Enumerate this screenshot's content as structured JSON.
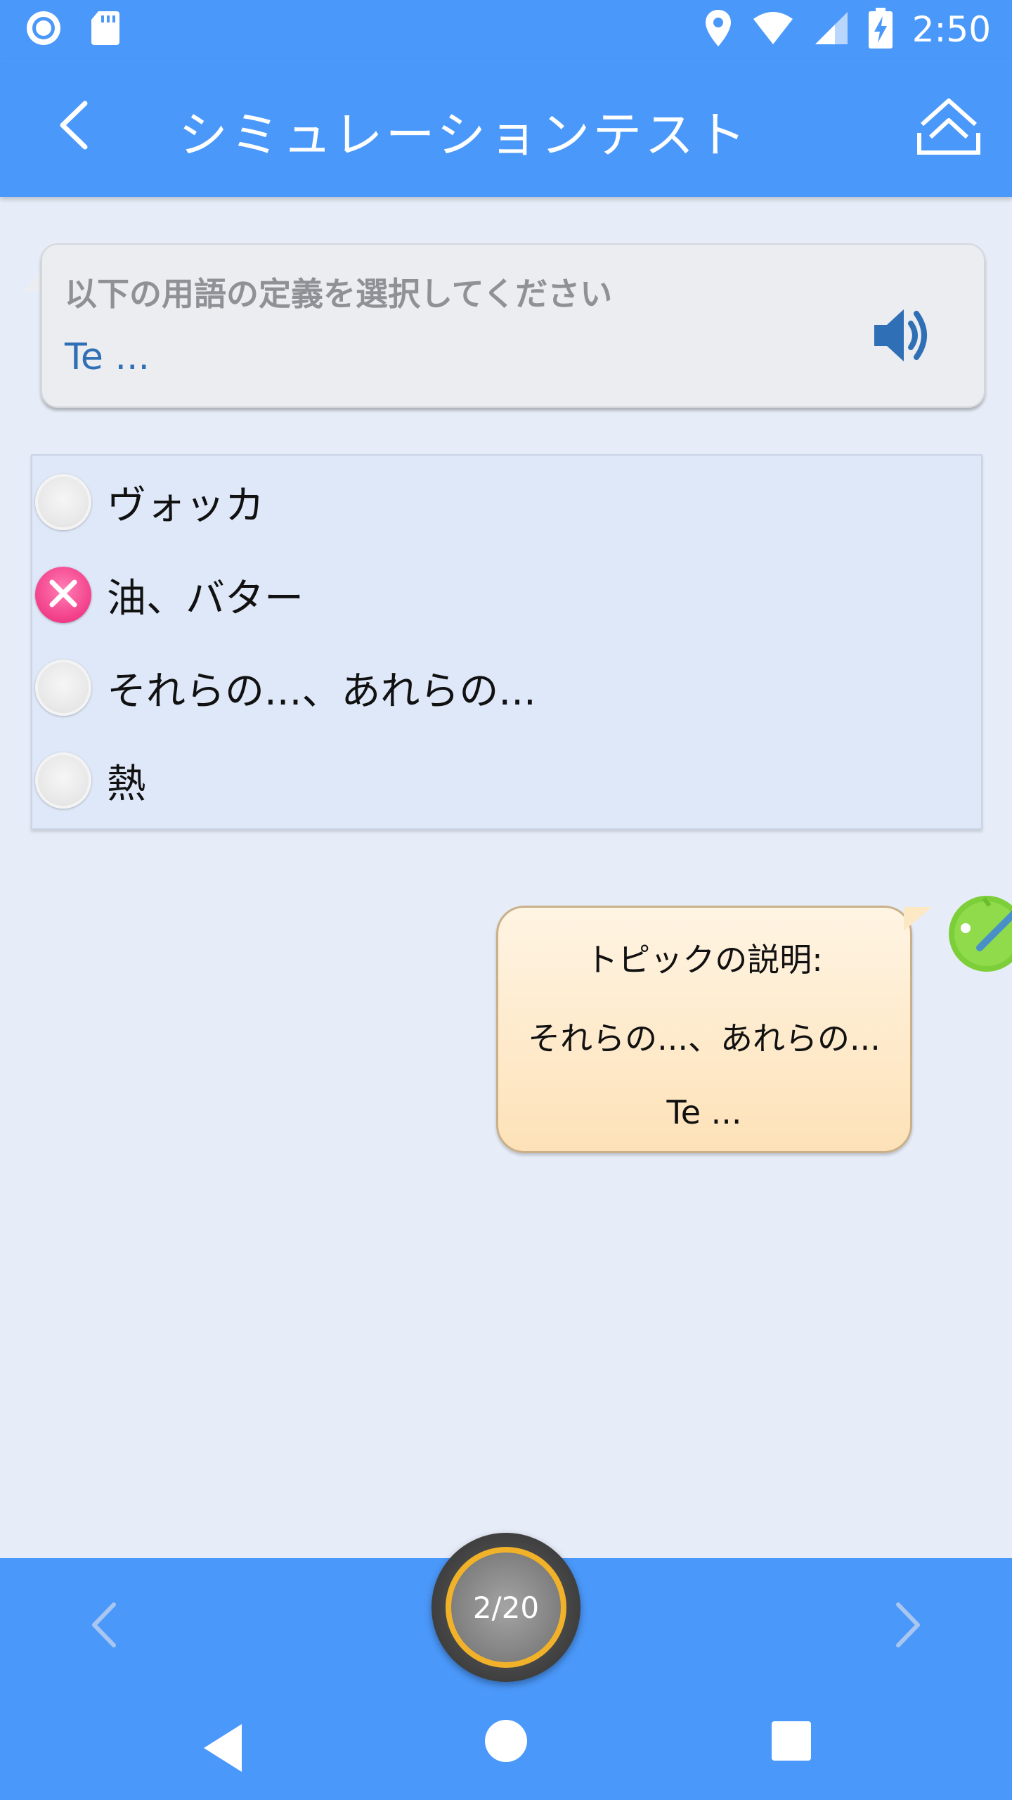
{
  "status_bar": {
    "time": "2:50",
    "icons": [
      "record-icon",
      "sd-card-icon",
      "location-icon",
      "wifi-icon",
      "signal-icon",
      "battery-charging-icon"
    ]
  },
  "app_bar": {
    "title": "シミュレーションテスト",
    "back_icon": "chevron-left-icon",
    "action_icon": "scroll-to-top-icon"
  },
  "question": {
    "prompt": "以下の用語の定義を選択してください",
    "term": "Te ...",
    "audio_icon": "speaker-icon"
  },
  "options": [
    {
      "label": "ヴォッカ",
      "state": "unselected"
    },
    {
      "label": "油、バター",
      "state": "wrong"
    },
    {
      "label": "それらの...、あれらの...",
      "state": "unselected"
    },
    {
      "label": "熱",
      "state": "unselected"
    }
  ],
  "explanation": {
    "heading": "トピックの説明:",
    "definition": "それらの...、あれらの...",
    "term": "Te ..."
  },
  "bottom_nav": {
    "progress": "2/20",
    "current": 2,
    "total": 20
  },
  "colors": {
    "primary": "#4a98fa",
    "background": "#e7edf8",
    "wrong": "#f23e89",
    "progress_ring": "#f1b22a",
    "term_text": "#2f6fb5"
  }
}
